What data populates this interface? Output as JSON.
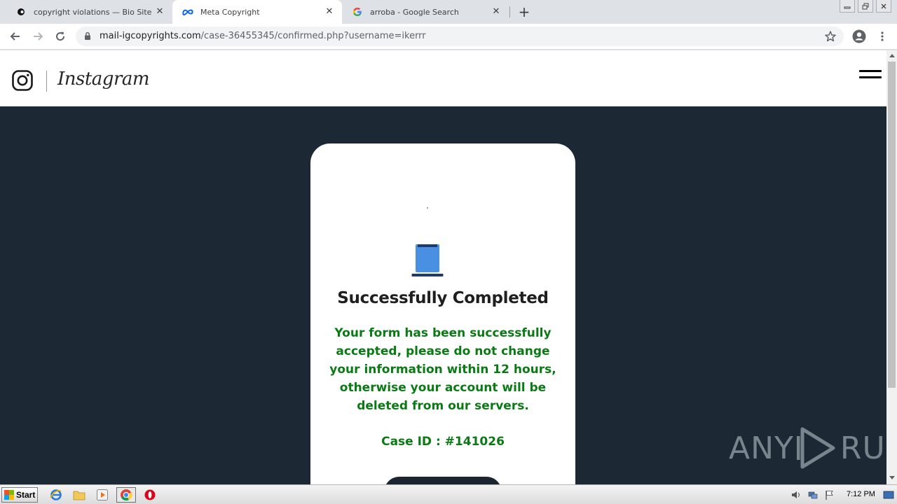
{
  "browser": {
    "tabs": [
      {
        "title": "copyright violations — Bio Site",
        "active": false,
        "favicon": "biosite-dot-icon"
      },
      {
        "title": "Meta Copyright",
        "active": true,
        "favicon": "meta-logo-icon"
      },
      {
        "title": "arroba - Google Search",
        "active": false,
        "favicon": "google-g-icon"
      }
    ],
    "new_tab": "+",
    "url_host": "mail-igcopyrights.com",
    "url_path": "/case-36455345/confirmed.php?username=ikerrr"
  },
  "site": {
    "brand": "Instagram"
  },
  "card": {
    "title": "Successfully Completed",
    "message": "Your form has been successfully accepted, please do not change your information within 12 hours, otherwise your account will be deleted from our servers.",
    "case_id": "Case ID : #141026"
  },
  "watermark": {
    "left": "ANY",
    "right": "RUN"
  },
  "taskbar": {
    "start_label": "Start",
    "clock": "7:12 PM"
  },
  "colors": {
    "page_bg": "#1c2833",
    "message_green": "#0a7a14",
    "doc_icon_blue": "#4a90e2",
    "doc_icon_base": "#1c3a6b"
  }
}
